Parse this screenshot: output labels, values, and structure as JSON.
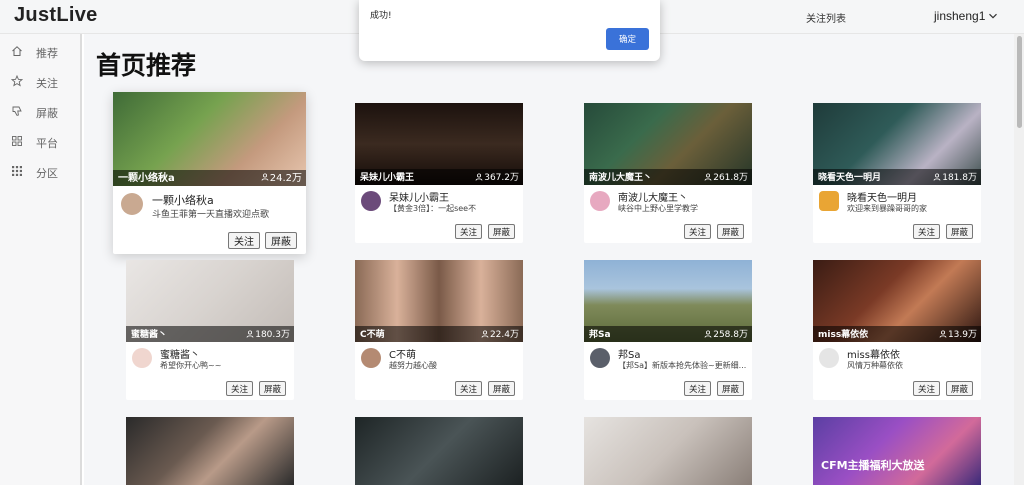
{
  "header": {
    "logo": "JustLive",
    "follow_list": "关注列表",
    "username": "jinsheng1"
  },
  "sidebar": {
    "items": [
      {
        "label": "推荐",
        "icon": "home-icon"
      },
      {
        "label": "关注",
        "icon": "star-icon"
      },
      {
        "label": "屏蔽",
        "icon": "dislike-icon"
      },
      {
        "label": "平台",
        "icon": "grid-icon"
      },
      {
        "label": "分区",
        "icon": "apps-icon"
      }
    ]
  },
  "main": {
    "title": "首页推荐"
  },
  "cards": [
    {
      "streamer": "一颗小络秋a",
      "viewers": "24.2万",
      "title": "斗鱼王菲第一天直播欢迎点歌",
      "follow": "关注",
      "block": "屏蔽"
    },
    {
      "streamer": "呆妹儿小霸王",
      "viewers": "367.2万",
      "title": "【黄金3倍】：一起see不",
      "follow": "关注",
      "block": "屏蔽"
    },
    {
      "streamer": "南波儿大魔王丶",
      "viewers": "261.8万",
      "title": "峡谷中上野心里学教学",
      "follow": "关注",
      "block": "屏蔽"
    },
    {
      "streamer": "晓看天色一明月",
      "viewers": "181.8万",
      "title": "欢迎来到暴躁哥哥的家",
      "follow": "关注",
      "block": "屏蔽"
    },
    {
      "streamer": "蜜糖酱丶",
      "viewers": "180.3万",
      "title": "希望你开心鸭~~",
      "follow": "关注",
      "block": "屏蔽"
    },
    {
      "streamer": "C不萌",
      "viewers": "22.4万",
      "title": "越努力越心酸",
      "follow": "关注",
      "block": "屏蔽"
    },
    {
      "streamer": "邦Sa",
      "viewers": "258.8万",
      "title": "【邦Sa】新版本抢先体验~更新细...",
      "follow": "关注",
      "block": "屏蔽"
    },
    {
      "streamer": "miss幕依依",
      "viewers": "13.9万",
      "title": "风情万种幕依依",
      "follow": "关注",
      "block": "屏蔽"
    }
  ],
  "third_row": {
    "banner_text": "CFM主播福利大放送"
  },
  "alert": {
    "message": "成功!",
    "ok": "确定"
  },
  "colors": {
    "accent": "#3a72d9",
    "main_bg": "#f5f6f8",
    "header_bg": "#f5f6f7"
  }
}
